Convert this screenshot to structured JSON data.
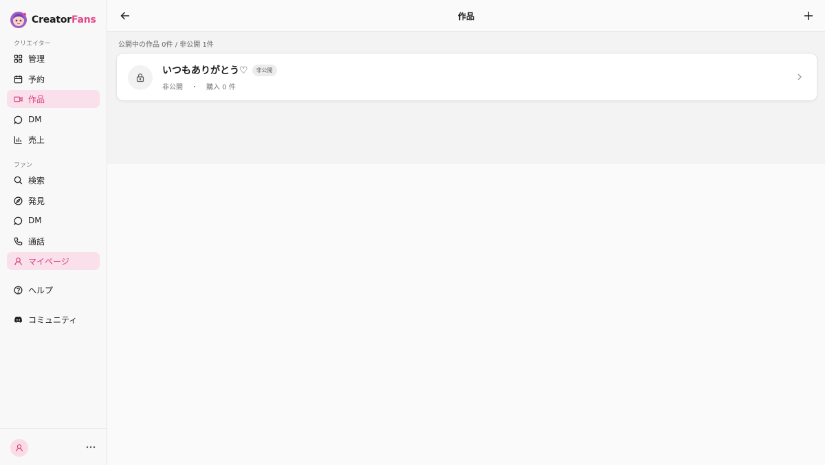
{
  "brand": {
    "name_part1": "Creator",
    "name_part2": "Fans"
  },
  "sidebar": {
    "creator_label": "クリエイター",
    "creator_items": [
      {
        "label": "管理",
        "icon": "grid-icon",
        "active": false
      },
      {
        "label": "予約",
        "icon": "calendar-icon",
        "active": false
      },
      {
        "label": "作品",
        "icon": "video-icon",
        "active": true
      },
      {
        "label": "DM",
        "icon": "chat-bubble-icon",
        "active": false
      },
      {
        "label": "売上",
        "icon": "bar-chart-icon",
        "active": false
      }
    ],
    "fan_label": "ファン",
    "fan_items": [
      {
        "label": "検索",
        "icon": "search-icon",
        "active": false
      },
      {
        "label": "発見",
        "icon": "compass-icon",
        "active": false
      },
      {
        "label": "DM",
        "icon": "chat-bubble-icon",
        "active": false
      },
      {
        "label": "通話",
        "icon": "phone-icon",
        "active": false
      },
      {
        "label": "マイページ",
        "icon": "user-icon",
        "active": true
      }
    ],
    "help_label": "ヘルプ",
    "community_label": "コミュニティ"
  },
  "header": {
    "title": "作品"
  },
  "main": {
    "summary": "公開中の作品 0件 / 非公開 1件",
    "works": [
      {
        "title": "いつもありがとう♡",
        "badge": "非公開",
        "status": "非公開",
        "separator": "・",
        "purchases": "購入 0 件"
      }
    ]
  },
  "colors": {
    "accent": "#e4468d",
    "active_bg": "#fae0ea",
    "active_text": "#d8417f"
  }
}
